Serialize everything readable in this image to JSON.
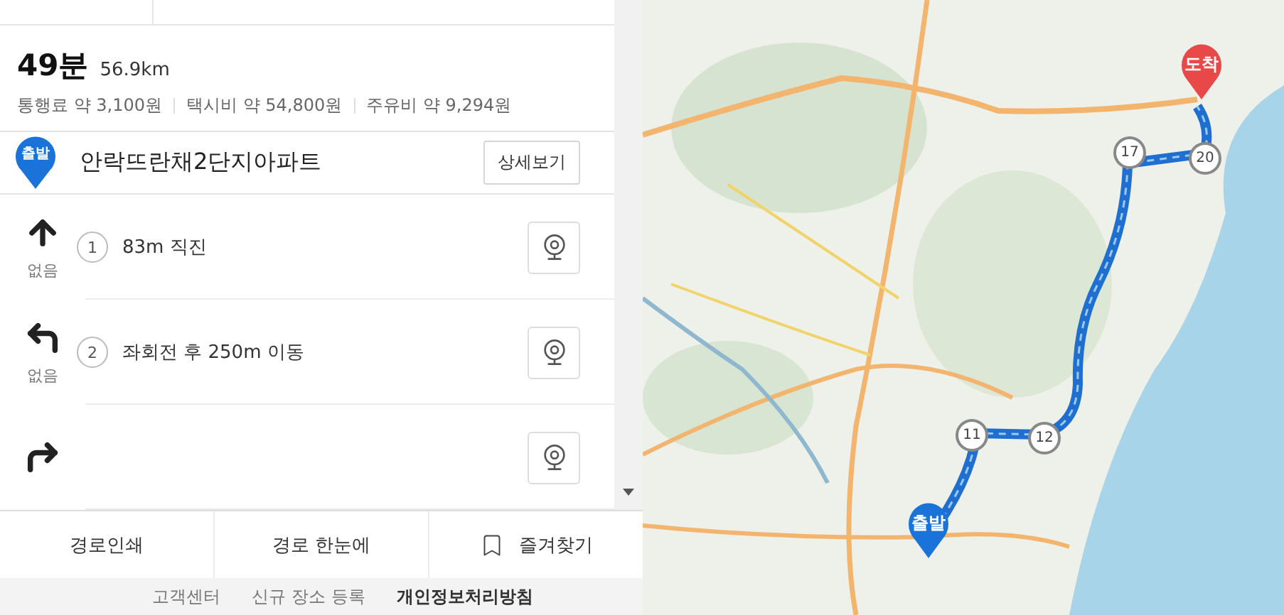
{
  "summary": {
    "duration": "49분",
    "distance": "56.9km",
    "costs": [
      "통행료 약 3,100원",
      "택시비 약 54,800원",
      "주유비 약 9,294원"
    ]
  },
  "start": {
    "badge": "출발",
    "name": "안락뜨란채2단지아파트",
    "detail_button": "상세보기"
  },
  "steps": [
    {
      "kind": "straight",
      "sub": "없음",
      "number": "1",
      "text": "83m 직진"
    },
    {
      "kind": "left",
      "sub": "없음",
      "number": "2",
      "text": "좌회전 후 250m 이동"
    },
    {
      "kind": "right"
    }
  ],
  "actions": [
    {
      "kind": "plain",
      "label": "경로인쇄"
    },
    {
      "kind": "plain",
      "label": "경로 한눈에"
    },
    {
      "kind": "bookmark",
      "label": "즐겨찾기"
    }
  ],
  "footer_links": [
    {
      "label": "고객센터",
      "bold": false
    },
    {
      "label": "신규 장소 등록",
      "bold": false
    },
    {
      "label": "개인정보처리방침",
      "bold": true
    }
  ],
  "map": {
    "kind": "picture",
    "pins": [
      {
        "kind": "start",
        "label": "출발"
      },
      {
        "kind": "end",
        "label": "도착"
      }
    ],
    "waypoints": [
      "17",
      "20",
      "11",
      "12"
    ]
  }
}
